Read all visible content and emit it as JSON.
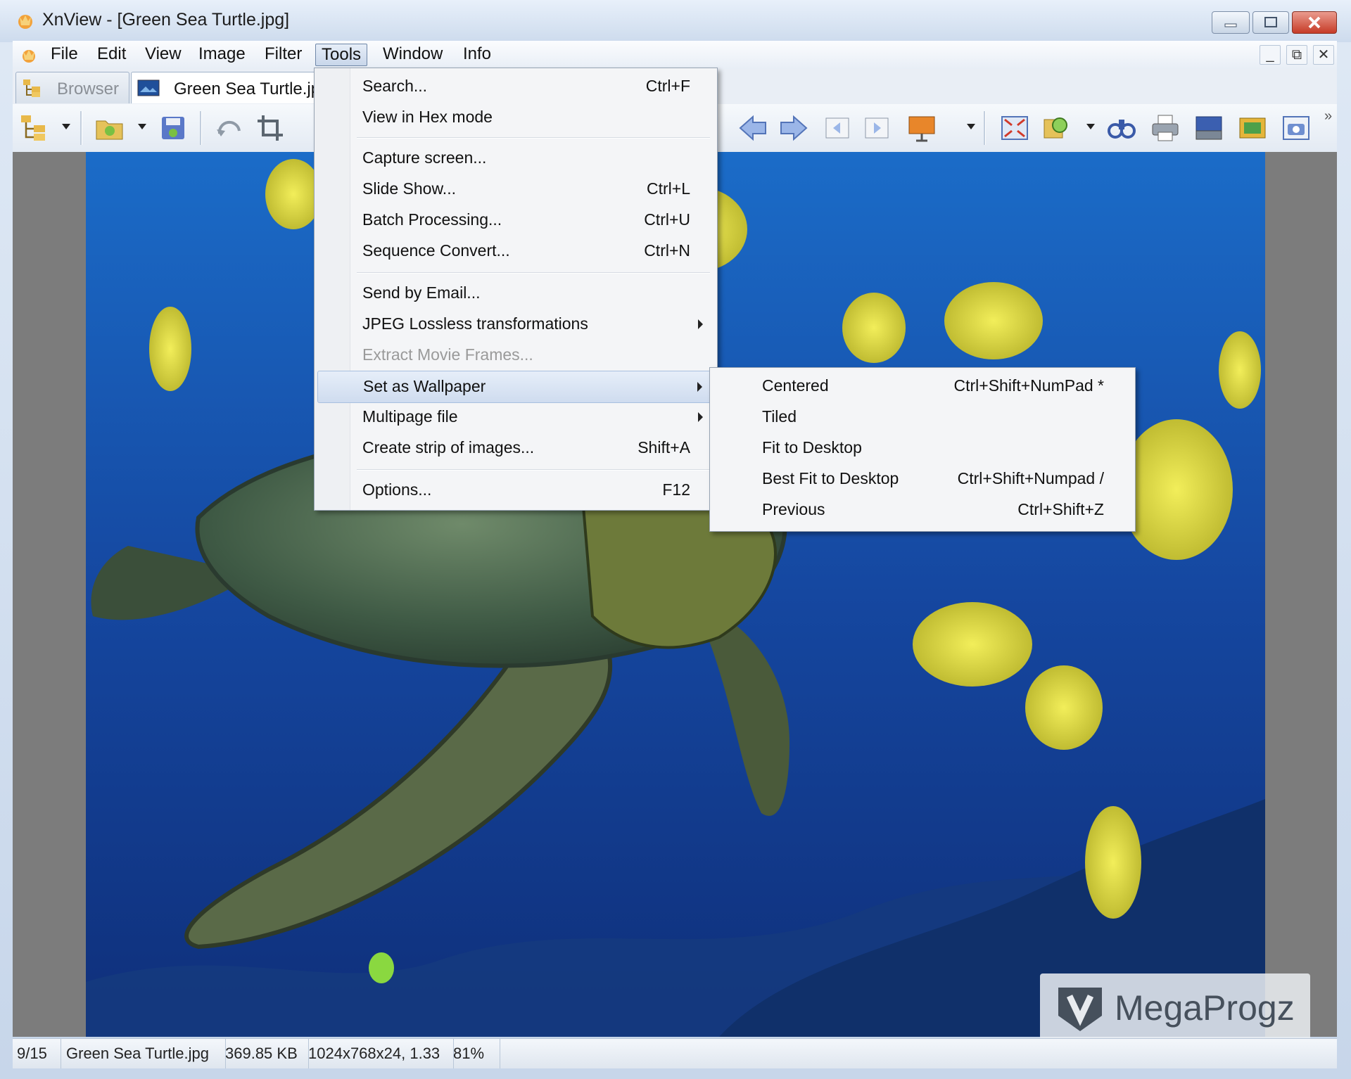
{
  "window": {
    "title": "XnView - [Green Sea Turtle.jpg]"
  },
  "menubar": {
    "items": [
      "File",
      "Edit",
      "View",
      "Image",
      "Filter",
      "Tools",
      "Window",
      "Info"
    ],
    "active": "Tools"
  },
  "tabs": [
    {
      "label": "Browser",
      "active": false
    },
    {
      "label": "Green Sea Turtle.jpg",
      "active": true
    }
  ],
  "toolbar": {
    "icons": [
      "browser-tree-icon",
      "open-folder-icon",
      "save-icon",
      "rotate-icon",
      "crop-icon",
      "previous-icon",
      "next-icon",
      "first-page-icon",
      "last-page-icon",
      "slideshow-icon",
      "fit-to-screen-icon",
      "zoom-icon",
      "find-icon",
      "print-icon",
      "scanner-icon",
      "wallpaper-icon",
      "capture-icon"
    ]
  },
  "tools_menu": {
    "items": [
      {
        "label": "Search...",
        "shortcut": "Ctrl+F"
      },
      {
        "label": "View in Hex mode",
        "shortcut": ""
      },
      {
        "label": "Capture screen...",
        "shortcut": ""
      },
      {
        "label": "Slide Show...",
        "shortcut": "Ctrl+L"
      },
      {
        "label": "Batch Processing...",
        "shortcut": "Ctrl+U"
      },
      {
        "label": "Sequence Convert...",
        "shortcut": "Ctrl+N"
      },
      {
        "label": "Send by Email...",
        "shortcut": ""
      },
      {
        "label": "JPEG Lossless transformations",
        "shortcut": "",
        "submenu": true
      },
      {
        "label": "Extract Movie Frames...",
        "shortcut": "",
        "disabled": true
      },
      {
        "label": "Set as Wallpaper",
        "shortcut": "",
        "submenu": true,
        "highlighted": true
      },
      {
        "label": "Multipage file",
        "shortcut": "",
        "submenu": true
      },
      {
        "label": "Create strip of images...",
        "shortcut": "Shift+A"
      },
      {
        "label": "Options...",
        "shortcut": "F12"
      }
    ]
  },
  "wallpaper_submenu": {
    "items": [
      {
        "label": "Centered",
        "shortcut": "Ctrl+Shift+NumPad *"
      },
      {
        "label": "Tiled",
        "shortcut": ""
      },
      {
        "label": "Fit to Desktop",
        "shortcut": ""
      },
      {
        "label": "Best Fit to Desktop",
        "shortcut": "Ctrl+Shift+Numpad /"
      },
      {
        "label": "Previous",
        "shortcut": "Ctrl+Shift+Z"
      }
    ]
  },
  "statusbar": {
    "index": "9/15",
    "filename": "Green Sea Turtle.jpg",
    "filesize": "369.85 KB",
    "dimensions": "1024x768x24, 1.33",
    "zoom": "81%"
  },
  "watermark": {
    "text": "MegaProgz"
  },
  "colors": {
    "titlebar": "#cddbed",
    "menu_highlight": "#cfdcef",
    "close_button": "#c63b27",
    "water_blue": "#1a4fa6",
    "fish_yellow": "#e2dc3a"
  }
}
